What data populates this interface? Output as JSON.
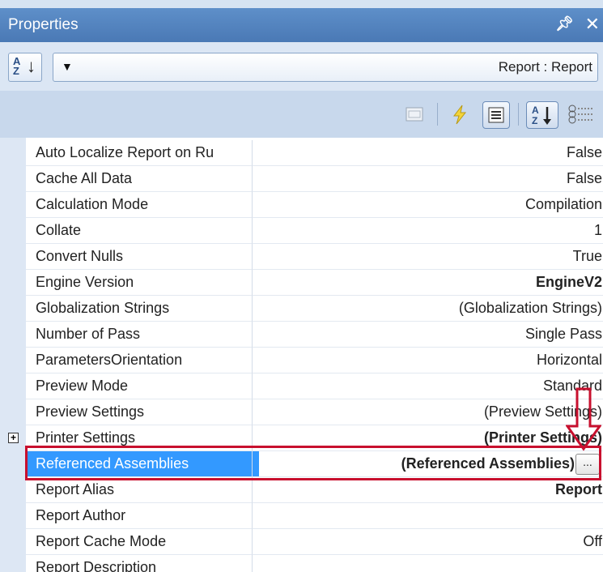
{
  "window": {
    "title": "Properties",
    "pin_icon": "pin-icon",
    "close_icon": "close-icon"
  },
  "selector": {
    "sort_icon": "sort-az-icon",
    "selected_object": "Report : Report"
  },
  "toolbar": {
    "icons": [
      "property-pages-icon",
      "events-icon",
      "properties-icon",
      "sort-alphabetical-icon",
      "categorized-icon"
    ]
  },
  "properties": [
    {
      "name": "Auto Localize Report on Ru",
      "value": "False"
    },
    {
      "name": "Cache All Data",
      "value": "False"
    },
    {
      "name": "Calculation Mode",
      "value": "Compilation"
    },
    {
      "name": "Collate",
      "value": "1"
    },
    {
      "name": "Convert Nulls",
      "value": "True"
    },
    {
      "name": "Engine Version",
      "value": "EngineV2",
      "bold": true
    },
    {
      "name": "Globalization Strings",
      "value": "(Globalization Strings)"
    },
    {
      "name": "Number of Pass",
      "value": "Single Pass"
    },
    {
      "name": "ParametersOrientation",
      "value": "Horizontal"
    },
    {
      "name": "Preview Mode",
      "value": "Standard"
    },
    {
      "name": "Preview Settings",
      "value": "(Preview Settings)"
    },
    {
      "name": "Printer Settings",
      "value": "(Printer Settings)",
      "bold": true,
      "expandable": true,
      "expand_glyph": "+"
    },
    {
      "name": "Referenced Assemblies",
      "value": "(Referenced Assemblies)",
      "bold": true,
      "selected": true,
      "ellipsis": "..."
    },
    {
      "name": "Report Alias",
      "value": "Report",
      "bold": true
    },
    {
      "name": "Report Author",
      "value": ""
    },
    {
      "name": "Report Cache Mode",
      "value": "Off"
    },
    {
      "name": "Report Description",
      "value": ""
    }
  ],
  "colors": {
    "title_bar": "#4a79b5",
    "selection": "#3399ff",
    "annotation": "#c8102e"
  }
}
